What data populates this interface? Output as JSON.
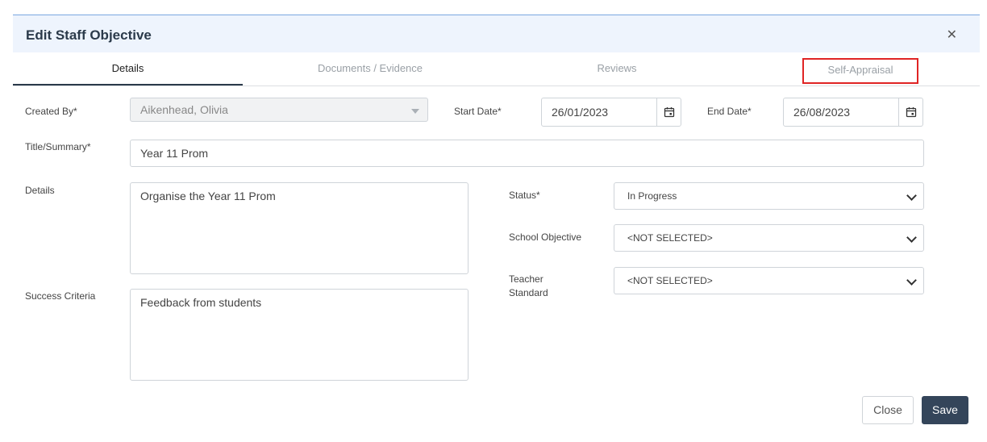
{
  "modal": {
    "title": "Edit Staff Objective",
    "close_icon": "close-icon"
  },
  "tabs": [
    {
      "label": "Details",
      "active": true
    },
    {
      "label": "Documents / Evidence",
      "active": false
    },
    {
      "label": "Reviews",
      "active": false
    },
    {
      "label": "Self-Appraisal",
      "active": false,
      "highlighted": true
    }
  ],
  "form": {
    "created_by": {
      "label": "Created By*",
      "value": "Aikenhead, Olivia"
    },
    "start_date": {
      "label": "Start Date*",
      "value": "26/01/2023"
    },
    "end_date": {
      "label": "End Date*",
      "value": "26/08/2023"
    },
    "title": {
      "label": "Title/Summary*",
      "value": "Year 11 Prom"
    },
    "details": {
      "label": "Details",
      "value": "Organise the Year 11 Prom"
    },
    "success_criteria": {
      "label": "Success Criteria",
      "value": "Feedback from students"
    },
    "status": {
      "label": "Status*",
      "value": "In Progress"
    },
    "school_objective": {
      "label": "School Objective",
      "value": "<NOT SELECTED>"
    },
    "teacher_standard": {
      "label_line1": "Teacher",
      "label_line2": "Standard",
      "value": "<NOT SELECTED>"
    }
  },
  "buttons": {
    "close": "Close",
    "save": "Save"
  },
  "colors": {
    "header_bg": "#eef4fd",
    "save_bg": "#34455a",
    "highlight_border": "#e02424"
  }
}
